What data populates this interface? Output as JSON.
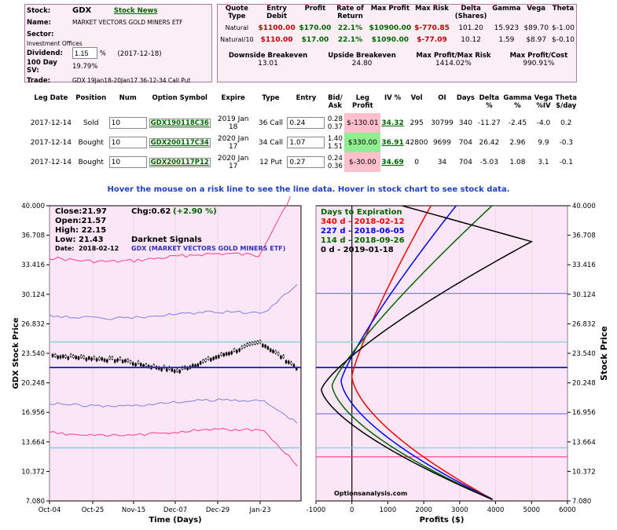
{
  "stock": {
    "label_stock": "Stock:",
    "symbol": "GDX",
    "news_link": "Stock News",
    "label_name": "Name:",
    "name": "MARKET VECTORS GOLD MINERS ETF",
    "label_sector": "Sector:",
    "sector": "Investment Offices",
    "label_dividend": "Dividend:",
    "dividend_value": "1.15",
    "dividend_pct": "%",
    "dividend_date": "(2017-12-18)",
    "label_sv": "100 Day SV:",
    "sv": "19.79%",
    "label_trade": "Trade:",
    "trade": "GDX 19Jan18-20Jan17 36-12-34 Call Put"
  },
  "quote": {
    "headers": [
      "Quote Type",
      "Entry Debit",
      "Profit",
      "Rate of Return",
      "Max Profit",
      "Max Risk",
      "Delta (Shares)",
      "Gamma",
      "Vega",
      "Theta"
    ],
    "rows": [
      [
        "Natural",
        "$1100.00",
        "$170.00",
        "22.1%",
        "$10900.00",
        "$-770.85",
        "101.20",
        "15.923",
        "$89.70",
        "$-1.00"
      ],
      [
        "Natural/10",
        "$110.00",
        "$17.00",
        "22.1%",
        "$1090.00",
        "$-77.09",
        "10.12",
        "1.59",
        "$8.97",
        "$-0.10"
      ]
    ],
    "summary_headers": [
      "Downside Breakeven",
      "Upside Breakeven",
      "Max Profit/Max Risk",
      "Max Profit/Cost"
    ],
    "summary_values": [
      "13.01",
      "24.80",
      "1414.02%",
      "990.91%"
    ]
  },
  "legs": {
    "headers": [
      "Leg Date",
      "Position",
      "Num",
      "Option Symbol",
      "Expire",
      "Type",
      "Entry",
      "Bid/ Ask",
      "Leg Profit",
      "IV %",
      "Vol",
      "OI",
      "Days",
      "Delta %",
      "Gamma %",
      "Vega %IV",
      "Theta $/day"
    ],
    "rows": [
      {
        "date": "2017-12-14",
        "pos": "Sold",
        "num": "10",
        "sym": "GDX190118C36",
        "expire": "2019 Jan 18",
        "type": "36 Call",
        "entry": "0.24",
        "bid": "0.28",
        "ask": "0.37",
        "profit": "$-130.01",
        "iv": "34.32",
        "vol": "295",
        "oi": "30799",
        "days": "340",
        "delta": "-11.27",
        "gamma": "-2.45",
        "vega": "-4.0",
        "theta": "0.2"
      },
      {
        "date": "2017-12-14",
        "pos": "Bought",
        "num": "10",
        "sym": "GDX200117C34",
        "expire": "2020 Jan 17",
        "type": "34 Call",
        "entry": "1.07",
        "bid": "1.40",
        "ask": "1.51",
        "profit": "$330.00",
        "iv": "36.91",
        "vol": "42800",
        "oi": "9699",
        "days": "704",
        "delta": "26.42",
        "gamma": "2.96",
        "vega": "9.9",
        "theta": "-0.3"
      },
      {
        "date": "2017-12-14",
        "pos": "Bought",
        "num": "10",
        "sym": "GDX200117P12",
        "expire": "2020 Jan 17",
        "type": "12 Put",
        "entry": "0.27",
        "bid": "0.24",
        "ask": "0.36",
        "profit": "$-30.00",
        "iv": "34.69",
        "vol": "0",
        "oi": "34",
        "days": "704",
        "delta": "-5.03",
        "gamma": "1.08",
        "vega": "3.1",
        "theta": "-0.1"
      }
    ]
  },
  "hover_msg": "Hover the mouse on a risk line to see the line data. Hover in stock chart to see stock data.",
  "left_chart": {
    "close": "Close:21.97",
    "chg": "Chg:0.62",
    "chg_pct": "(+2.90 %)",
    "open": "Open:21.57",
    "high": "High: 22.15",
    "low": "Low: 21.43",
    "darknet": "Darknet Signals",
    "date_label": "Date:",
    "date": "2018-02-12",
    "name": "GDX (MARKET VECTORS GOLD MINERS ETF)",
    "ylabel": "GDX Stock Price",
    "xlabel": "Time (Days)",
    "x_ticks": [
      "Oct-04",
      "Oct-25",
      "Nov-15",
      "Dec-07",
      "Dec-29",
      "Jan-23"
    ]
  },
  "right_chart": {
    "legend_title": "Days to Expiration",
    "legend": [
      {
        "label": "340 d - 2018-02-12",
        "color": "#ff0000"
      },
      {
        "label": "227 d - 2018-06-05",
        "color": "#0000ff"
      },
      {
        "label": "114 d - 2018-09-26",
        "color": "#006400"
      },
      {
        "label": "0 d - 2019-01-18",
        "color": "#000000"
      }
    ],
    "watermark": "Optionsanalysis.com",
    "ylabel": "Stock Price",
    "xlabel": "Profits ($)",
    "x_ticks": [
      "-1000",
      "0",
      "1000",
      "2000",
      "3000",
      "4000",
      "5000",
      "6000"
    ]
  },
  "y_ticks": [
    "40.000",
    "36.708",
    "33.416",
    "30.124",
    "26.832",
    "23.540",
    "20.248",
    "16.956",
    "13.664",
    "10.372",
    "7.080"
  ],
  "colors": {
    "pink_bg": "#fbeef5",
    "plot_bg": "#fbe6f5",
    "current_price": "#3030c0",
    "upper_band": "#ff3c8c",
    "mid_band": "#8080e0",
    "light_line": "#80d0e0"
  }
}
